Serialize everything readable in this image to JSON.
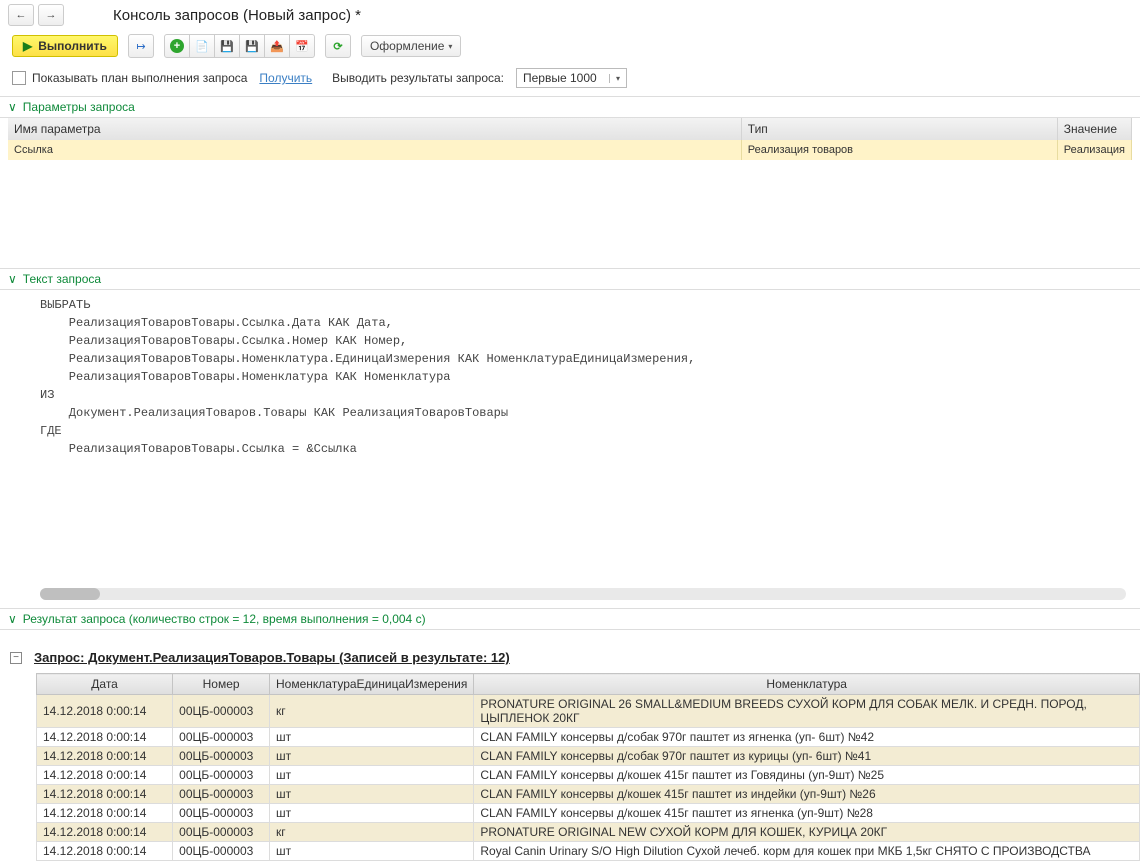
{
  "header": {
    "title": "Консоль запросов (Новый запрос) *"
  },
  "toolbar": {
    "execute_label": "Выполнить",
    "format_label": "Оформление"
  },
  "icons": {
    "back": "←",
    "fwd": "→",
    "play": "▶",
    "step": "↦",
    "add": "+",
    "open": "📄",
    "save1": "💾",
    "save2": "💾",
    "export": "📤",
    "grid": "📅",
    "refresh": "⟳",
    "caret": "▾",
    "chev": "∨"
  },
  "options": {
    "show_plan_label": "Показывать план выполнения запроса",
    "get_link": "Получить",
    "output_label": "Выводить результаты запроса:",
    "output_value": "Первые 1000"
  },
  "params_section": {
    "title": "Параметры запроса"
  },
  "params_table": {
    "headers": {
      "name": "Имя параметра",
      "type": "Тип",
      "value": "Значение"
    },
    "row": {
      "name": "Ссылка",
      "type": "Реализация товаров",
      "value": "Реализация"
    }
  },
  "query_section": {
    "title": "Текст запроса"
  },
  "query_lines": [
    "ВЫБРАТЬ",
    "    РеализацияТоваровТовары.Ссылка.Дата КАК Дата,",
    "    РеализацияТоваровТовары.Ссылка.Номер КАК Номер,",
    "    РеализацияТоваровТовары.Номенклатура.ЕдиницаИзмерения КАК НоменклатураЕдиницаИзмерения,",
    "    РеализацияТоваровТовары.Номенклатура КАК Номенклатура",
    "ИЗ",
    "    Документ.РеализацияТоваров.Товары КАК РеализацияТоваровТовары",
    "ГДЕ",
    "    РеализацияТоваровТовары.Ссылка = &Ссылка"
  ],
  "result_section": {
    "title": "Результат запроса (количество строк = 12, время выполнения = 0,004 с)"
  },
  "results": {
    "title": "Запрос: Документ.РеализацияТоваров.Товары (Записей в результате: 12)",
    "expander": "−",
    "headers": {
      "date": "Дата",
      "number": "Номер",
      "unit": "НоменклатураЕдиницаИзмерения",
      "nom": "Номенклатура"
    },
    "rows": [
      {
        "date": "14.12.2018 0:00:14",
        "number": "00ЦБ-000003",
        "unit": "кг",
        "nom": "PRONATURE ORIGINAL 26 SMALL&MEDIUM BREEDS СУХОЙ КОРМ ДЛЯ СОБАК МЕЛК. И СРЕДН. ПОРОД, ЦЫПЛЕНОК 20КГ"
      },
      {
        "date": "14.12.2018 0:00:14",
        "number": "00ЦБ-000003",
        "unit": "шт",
        "nom": "CLAN  FAMILY консервы д/собак 970г паштет из ягненка (уп- 6шт) №42"
      },
      {
        "date": "14.12.2018 0:00:14",
        "number": "00ЦБ-000003",
        "unit": "шт",
        "nom": "CLAN  FAMILY консервы д/собак 970г паштет из курицы (уп- 6шт) №41"
      },
      {
        "date": "14.12.2018 0:00:14",
        "number": "00ЦБ-000003",
        "unit": "шт",
        "nom": "CLAN FAMILY консервы д/кошек 415г паштет из Говядины (уп-9шт) №25"
      },
      {
        "date": "14.12.2018 0:00:14",
        "number": "00ЦБ-000003",
        "unit": "шт",
        "nom": "CLAN FAMILY консервы д/кошек 415г паштет из индейки (уп-9шт) №26"
      },
      {
        "date": "14.12.2018 0:00:14",
        "number": "00ЦБ-000003",
        "unit": "шт",
        "nom": "CLAN FAMILY консервы д/кошек 415г паштет из ягненка (уп-9шт) №28"
      },
      {
        "date": "14.12.2018 0:00:14",
        "number": "00ЦБ-000003",
        "unit": "кг",
        "nom": "PRONATURE ORIGINAL NEW СУХОЙ КОРМ ДЛЯ КОШЕК, КУРИЦА 20КГ"
      },
      {
        "date": "14.12.2018 0:00:14",
        "number": "00ЦБ-000003",
        "unit": "шт",
        "nom": "Royal Canin Urinary S/O High Dilution Сухой лечеб. корм для кошек при МКБ 1,5кг СНЯТО С ПРОИЗВОДСТВА"
      }
    ]
  }
}
